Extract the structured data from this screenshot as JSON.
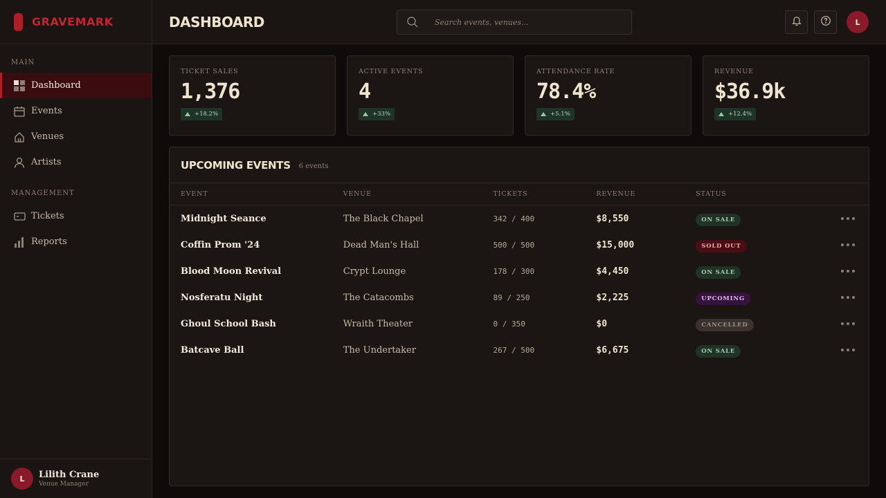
{
  "brand": {
    "name": "GRAVEMARK",
    "color": "#b01e28"
  },
  "sidebar": {
    "sections": [
      {
        "title": "MAIN",
        "items": [
          {
            "label": "Dashboard",
            "icon": "dashboard-icon",
            "active": true
          },
          {
            "label": "Events",
            "icon": "calendar-icon"
          },
          {
            "label": "Venues",
            "icon": "home-icon"
          },
          {
            "label": "Artists",
            "icon": "user-icon"
          }
        ]
      },
      {
        "title": "MANAGEMENT",
        "items": [
          {
            "label": "Tickets",
            "icon": "ticket-icon"
          },
          {
            "label": "Reports",
            "icon": "bar-chart-icon"
          }
        ]
      }
    ],
    "user": {
      "initial": "L",
      "name": "Lilith Crane",
      "role": "Venue Manager"
    }
  },
  "header": {
    "title": "DASHBOARD",
    "search": {
      "placeholder": "Search events, venues...",
      "value": ""
    },
    "avatar_initial": "L"
  },
  "stats": [
    {
      "label": "TICKET SALES",
      "value": "1,376",
      "delta": "+18.2%"
    },
    {
      "label": "ACTIVE EVENTS",
      "value": "4",
      "delta": "+33%"
    },
    {
      "label": "ATTENDANCE RATE",
      "value": "78.4%",
      "delta": "+5.1%"
    },
    {
      "label": "REVENUE",
      "value": "$36.9k",
      "delta": "+12.4%"
    }
  ],
  "events": {
    "title": "UPCOMING EVENTS",
    "count": "6 events",
    "columns": [
      "EVENT",
      "VENUE",
      "TICKETS",
      "REVENUE",
      "STATUS"
    ],
    "rows": [
      {
        "event": "Midnight Seance",
        "venue": "The Black Chapel",
        "tickets": "342 / 400",
        "revenue": "$8,550",
        "status": "ON SALE",
        "status_kind": "onsale"
      },
      {
        "event": "Coffin Prom '24",
        "venue": "Dead Man's Hall",
        "tickets": "500 / 500",
        "revenue": "$15,000",
        "status": "SOLD OUT",
        "status_kind": "soldout"
      },
      {
        "event": "Blood Moon Revival",
        "venue": "Crypt Lounge",
        "tickets": "178 / 300",
        "revenue": "$4,450",
        "status": "ON SALE",
        "status_kind": "onsale"
      },
      {
        "event": "Nosferatu Night",
        "venue": "The Catacombs",
        "tickets": "89 / 250",
        "revenue": "$2,225",
        "status": "UPCOMING",
        "status_kind": "upcoming"
      },
      {
        "event": "Ghoul School Bash",
        "venue": "Wraith Theater",
        "tickets": "0 / 350",
        "revenue": "$0",
        "status": "CANCELLED",
        "status_kind": "cancelled"
      },
      {
        "event": "Batcave Ball",
        "venue": "The Undertaker",
        "tickets": "267 / 500",
        "revenue": "$6,675",
        "status": "ON SALE",
        "status_kind": "onsale"
      }
    ]
  }
}
